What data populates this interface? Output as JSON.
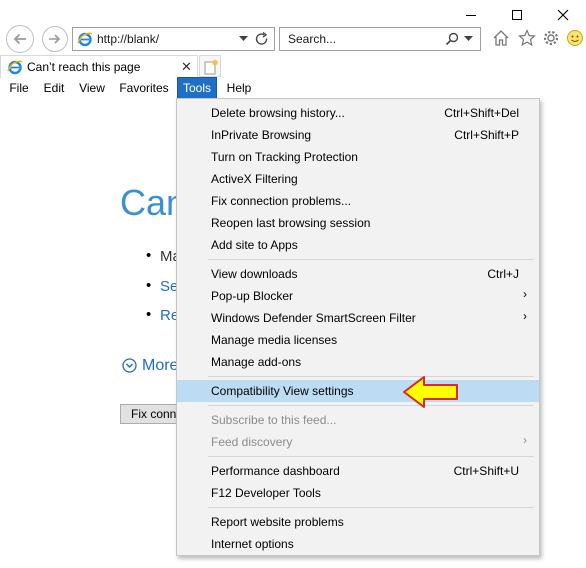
{
  "window": {
    "minimize_glyph": "—",
    "maximize_glyph": "☐",
    "close_glyph": "✕"
  },
  "address": {
    "value": "http://blank/",
    "search_placeholder": "Search..."
  },
  "tab": {
    "title": "Can’t reach this page",
    "close_glyph": "✕"
  },
  "menubar": {
    "items": [
      "File",
      "Edit",
      "View",
      "Favorites",
      "Tools",
      "Help"
    ]
  },
  "page": {
    "title": "Can",
    "bullets": [
      "Ma",
      "Se",
      "Re"
    ],
    "more": "More",
    "fix_button": "Fix conn"
  },
  "tools_menu": {
    "items": [
      {
        "label": "Delete browsing history...",
        "shortcut": "Ctrl+Shift+Del"
      },
      {
        "label": "InPrivate Browsing",
        "shortcut": "Ctrl+Shift+P"
      },
      {
        "label": "Turn on Tracking Protection",
        "shortcut": ""
      },
      {
        "label": "ActiveX Filtering",
        "shortcut": ""
      },
      {
        "label": "Fix connection problems...",
        "shortcut": ""
      },
      {
        "label": "Reopen last browsing session",
        "shortcut": ""
      },
      {
        "label": "Add site to Apps",
        "shortcut": ""
      },
      {
        "label": "View downloads",
        "shortcut": "Ctrl+J"
      },
      {
        "label": "Pop-up Blocker",
        "shortcut": ""
      },
      {
        "label": "Windows Defender SmartScreen Filter",
        "shortcut": ""
      },
      {
        "label": "Manage media licenses",
        "shortcut": ""
      },
      {
        "label": "Manage add-ons",
        "shortcut": ""
      },
      {
        "label": "Compatibility View settings",
        "shortcut": ""
      },
      {
        "label": "Subscribe to this feed...",
        "shortcut": ""
      },
      {
        "label": "Feed discovery",
        "shortcut": ""
      },
      {
        "label": "Performance dashboard",
        "shortcut": "Ctrl+Shift+U"
      },
      {
        "label": "F12 Developer Tools",
        "shortcut": ""
      },
      {
        "label": "Report website problems",
        "shortcut": ""
      },
      {
        "label": "Internet options",
        "shortcut": ""
      }
    ],
    "submenu_arrow": "›"
  },
  "colors": {
    "accent": "#1f6fc4",
    "highlight": "#bcdcf4",
    "arrow_fill": "#ffff00",
    "arrow_stroke": "#e0252b",
    "error_title": "#3c8fd2"
  }
}
